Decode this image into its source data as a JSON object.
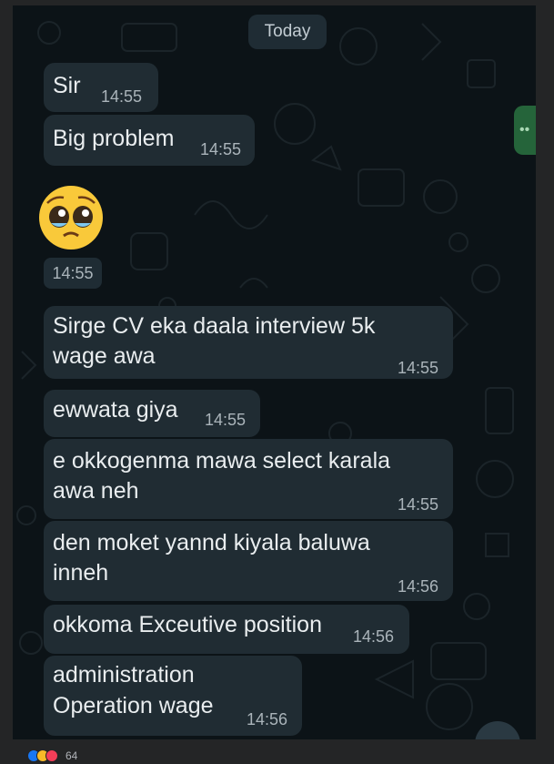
{
  "date_divider": "Today",
  "messages": [
    {
      "text": "Sir",
      "time": "14:55"
    },
    {
      "text": "Big problem",
      "time": "14:55"
    },
    {
      "emoji": "pleading-face",
      "time": "14:55"
    },
    {
      "lines": [
        "Sirge CV eka daala interview 5k",
        "wage awa"
      ],
      "time": "14:55"
    },
    {
      "text": "ewwata giya",
      "time": "14:55"
    },
    {
      "lines": [
        "e okkogenma mawa select karala",
        "awa neh"
      ],
      "time": "14:55"
    },
    {
      "lines": [
        "den moket yannd kiyala baluwa",
        "inneh"
      ],
      "time": "14:56"
    },
    {
      "text": "okkoma Exceutive position",
      "time": "14:56"
    },
    {
      "lines": [
        "administration",
        "Operation  wage"
      ],
      "time": "14:56"
    }
  ],
  "reactions": {
    "count": "64",
    "types": [
      "like-icon",
      "care-icon",
      "love-icon"
    ]
  },
  "colors": {
    "chat_bg": "#0c1317",
    "bubble_bg": "#202c33",
    "outer_bg": "#242526",
    "text": "#e9edef",
    "time": "#aab4ba"
  }
}
